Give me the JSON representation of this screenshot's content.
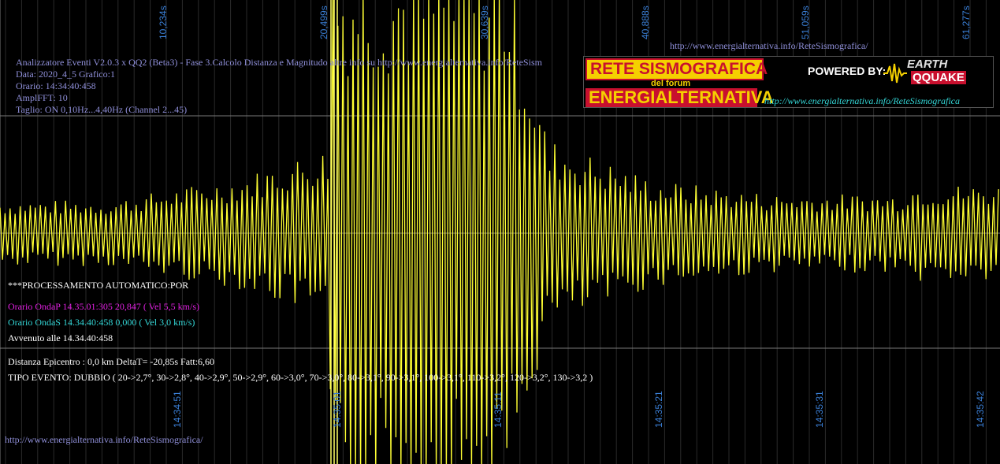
{
  "window": {
    "title": "Analizzatore Eventi V2.0.3 x QQ2 (Beta3) - Fase 3.Calcolo Distanza e Magnitudo altre info su http://www.energialternativa.info/ReteSism"
  },
  "colors": {
    "background": "#000000",
    "trace": "#ffff33",
    "grid": "#808080",
    "header_text": "#8f8fd9",
    "axis_label": "#3a7fd6",
    "onda_p": "#e020e0",
    "onda_s": "#33d6d6"
  },
  "header": {
    "line1": "Analizzatore Eventi V2.0.3 x QQ2 (Beta3) - Fase 3.Calcolo Distanza e Magnitudo altre info su http://www.energialternativa.info/ReteSism",
    "line2": "Data: 2020_4_5 Grafico:1",
    "line3": "Orario: 14:34:40:458",
    "line4": "AmplFFT: 10",
    "line5": "Taglio: ON 0,10Hz...4,40Hz       (Channel 2...45)"
  },
  "top_link": "http://www.energialternativa.info/ReteSismografica/",
  "bottom_link": "http://www.energialternativa.info/ReteSismografica/",
  "top_axis": [
    "10,234s",
    "20,499s",
    "30,639s",
    "40,888s",
    "51,059s",
    "61,277s"
  ],
  "bottom_axis": [
    "14:34:51",
    "14:35:01",
    "14:35:11",
    "14:35:21",
    "14:35:31",
    "14:35:42"
  ],
  "processing": {
    "title": "***PROCESSAMENTO AUTOMATICO:POR",
    "onda_p": "Orario OndaP 14.35.01:305  20,847 ( Vel 5,5 km/s)",
    "onda_s": "Orario OndaS 14.34.40:458  0,000 ( Vel 3,0 km/s)",
    "avvenuto": "Avvenuto alle 14.34.40:458"
  },
  "results": {
    "distanza": "Distanza Epicentro : 0,0 km DeltaT= -20,85s  Fatt:6,60",
    "tipo": "TIPO EVENTO: DUBBIO ( 20->2,7°, 30->2,8°, 40->2,9°, 50->2,9°, 60->3,0°, 70->3,0°, 80->3,1°, 90->3,1°, 100->3,1°, 110->3,2°, 120->3,2°, 130->3,2 )"
  },
  "logo": {
    "line1": "RETE SISMOGRAFICA",
    "line2": "del forum",
    "line3": "ENERGIALTERNATIVA",
    "powered": "POWERED BY:",
    "brand1": "EARTH",
    "brand2": "QQUAKE",
    "url": "http://www.energialternativa.info/ReteSismografica"
  }
}
